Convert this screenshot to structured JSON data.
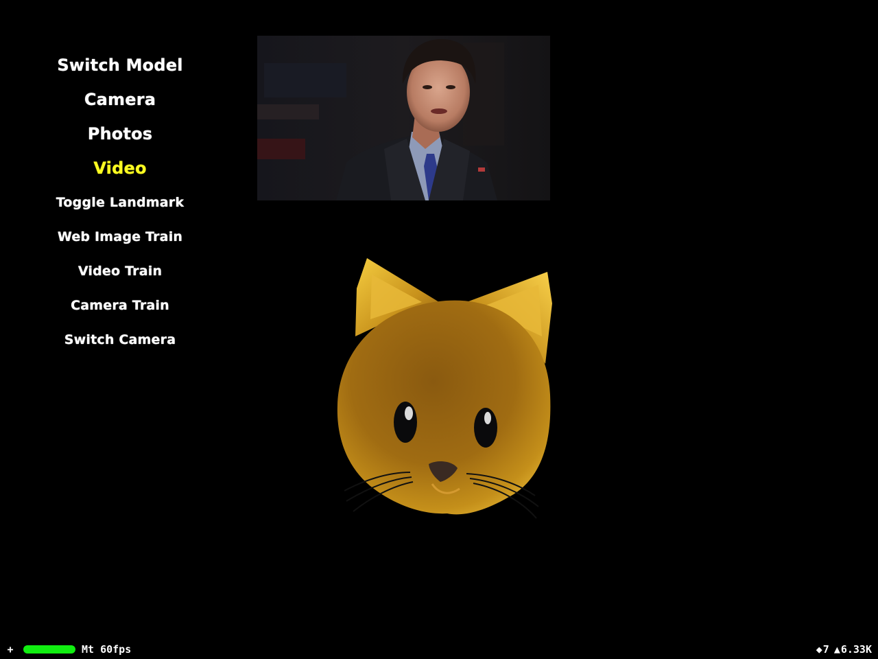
{
  "menu": {
    "items": [
      {
        "label": "Switch Model",
        "active": false
      },
      {
        "label": "Camera",
        "active": false
      },
      {
        "label": "Photos",
        "active": false
      },
      {
        "label": "Video",
        "active": true
      },
      {
        "label": "Toggle Landmark",
        "active": false
      },
      {
        "label": "Web Image Train",
        "active": false
      },
      {
        "label": "Video Train",
        "active": false
      },
      {
        "label": "Camera Train",
        "active": false
      },
      {
        "label": "Switch Camera",
        "active": false
      }
    ]
  },
  "colors": {
    "menu_text": "#ffffff",
    "menu_active": "#ffff22",
    "fps_bar": "#11ee11",
    "cat_fur": "#b07a14",
    "background": "#000000"
  },
  "video_preview": {
    "subject": "man-in-suit-speaking"
  },
  "avatar": {
    "model": "cat-emoji-face"
  },
  "stats": {
    "plus_label": "+",
    "fps_text": "Mt 60fps",
    "fps_level": 1.0,
    "draw_calls_icon": "diamond-icon",
    "draw_calls": "7",
    "triangles_icon": "triangle-icon",
    "triangles": "6.33K"
  }
}
